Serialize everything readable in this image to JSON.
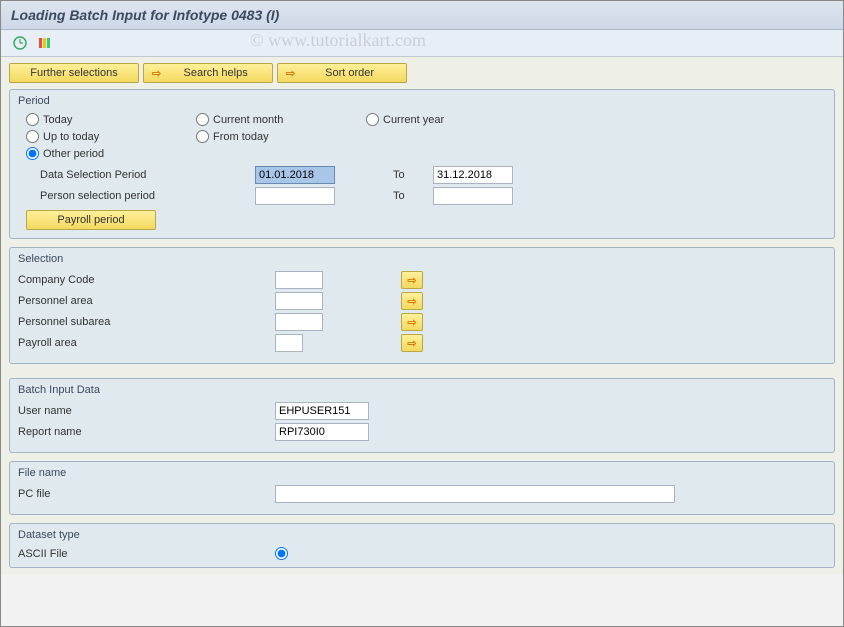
{
  "header": {
    "title": "Loading Batch Input for Infotype 0483 (I)"
  },
  "buttons": {
    "further_selections": "Further selections",
    "search_helps": "Search helps",
    "sort_order": "Sort order",
    "payroll_period": "Payroll period"
  },
  "period": {
    "title": "Period",
    "radios": {
      "today": "Today",
      "current_month": "Current month",
      "current_year": "Current year",
      "up_to_today": "Up to today",
      "from_today": "From today",
      "other_period": "Other period"
    },
    "data_selection_label": "Data Selection Period",
    "data_selection_from": "01.01.2018",
    "data_selection_to": "31.12.2018",
    "person_selection_label": "Person selection period",
    "person_selection_from": "",
    "person_selection_to": "",
    "to_label": "To"
  },
  "selection": {
    "title": "Selection",
    "company_code_label": "Company Code",
    "company_code": "",
    "personnel_area_label": "Personnel area",
    "personnel_area": "",
    "personnel_subarea_label": "Personnel subarea",
    "personnel_subarea": "",
    "payroll_area_label": "Payroll area",
    "payroll_area": ""
  },
  "batch_input": {
    "title": "Batch Input Data",
    "user_name_label": "User name",
    "user_name": "EHPUSER151",
    "report_name_label": "Report name",
    "report_name": "RPI730I0"
  },
  "file_name": {
    "title": "File name",
    "pc_file_label": "PC file",
    "pc_file": ""
  },
  "dataset_type": {
    "title": "Dataset type",
    "ascii_file_label": "ASCII File"
  },
  "watermark": "© www.tutorialkart.com"
}
